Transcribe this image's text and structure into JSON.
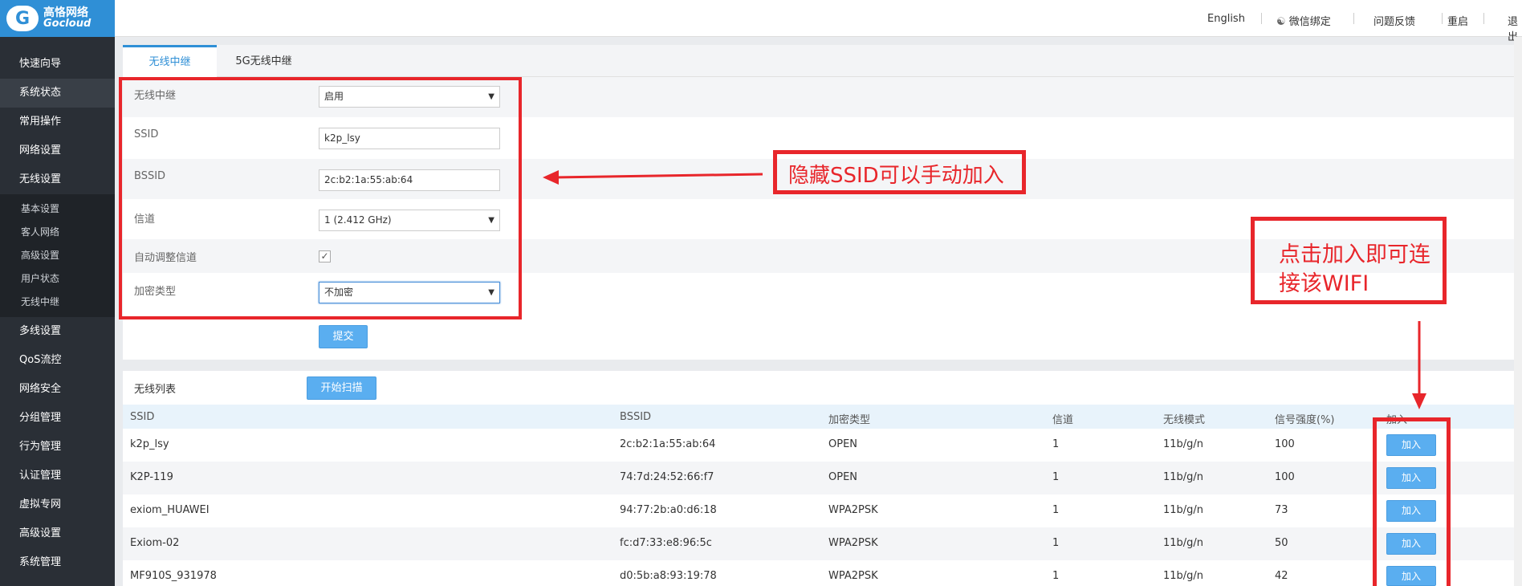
{
  "logo": {
    "line1": "高恪网络",
    "line2": "Gocloud"
  },
  "sidebar": {
    "items_top": [
      "快速向导",
      "系统状态",
      "常用操作",
      "网络设置",
      "无线设置"
    ],
    "sub_items": [
      "基本设置",
      "客人网络",
      "高级设置",
      "用户状态",
      "无线中继"
    ],
    "items_bottom": [
      "多线设置",
      "QoS流控",
      "网络安全",
      "分组管理",
      "行为管理",
      "认证管理",
      "虚拟专网",
      "高级设置",
      "系统管理"
    ]
  },
  "header": {
    "english": "English",
    "wechat": "微信绑定",
    "feedback": "问题反馈",
    "restart": "重启",
    "logout": "退出"
  },
  "tabs": [
    "无线中继",
    "5G无线中继"
  ],
  "form": {
    "relay_label": "无线中继",
    "relay_value": "启用",
    "ssid_label": "SSID",
    "ssid_value": "k2p_lsy",
    "bssid_label": "BSSID",
    "bssid_value": "2c:b2:1a:55:ab:64",
    "channel_label": "信道",
    "channel_value": "1 (2.412 GHz)",
    "auto_label": "自动调整信道",
    "enc_label": "加密类型",
    "enc_value": "不加密",
    "submit": "提交"
  },
  "list": {
    "title": "无线列表",
    "scan_button": "开始扫描",
    "columns": [
      "SSID",
      "BSSID",
      "加密类型",
      "信道",
      "无线模式",
      "信号强度(%)",
      "加入"
    ],
    "rows": [
      {
        "ssid": "k2p_lsy",
        "bssid": "2c:b2:1a:55:ab:64",
        "enc": "OPEN",
        "channel": "1",
        "mode": "11b/g/n",
        "signal": "100",
        "join": "加入"
      },
      {
        "ssid": "K2P-119",
        "bssid": "74:7d:24:52:66:f7",
        "enc": "OPEN",
        "channel": "1",
        "mode": "11b/g/n",
        "signal": "100",
        "join": "加入"
      },
      {
        "ssid": "exiom_HUAWEI",
        "bssid": "94:77:2b:a0:d6:18",
        "enc": "WPA2PSK",
        "channel": "1",
        "mode": "11b/g/n",
        "signal": "73",
        "join": "加入"
      },
      {
        "ssid": "Exiom-02",
        "bssid": "fc:d7:33:e8:96:5c",
        "enc": "WPA2PSK",
        "channel": "1",
        "mode": "11b/g/n",
        "signal": "50",
        "join": "加入"
      },
      {
        "ssid": "MF910S_931978",
        "bssid": "d0:5b:a8:93:19:78",
        "enc": "WPA2PSK",
        "channel": "1",
        "mode": "11b/g/n",
        "signal": "42",
        "join": "加入"
      }
    ]
  },
  "annotations": {
    "hidden_ssid": "隐藏SSID可以手动加入",
    "click_join_line1": "点击加入即可连",
    "click_join_line2": "接该WIFI"
  },
  "colors": {
    "accent": "#2f8fd6",
    "sidebar_bg": "#2a2f36",
    "annotation": "#e8262b",
    "button": "#5aaef0"
  }
}
